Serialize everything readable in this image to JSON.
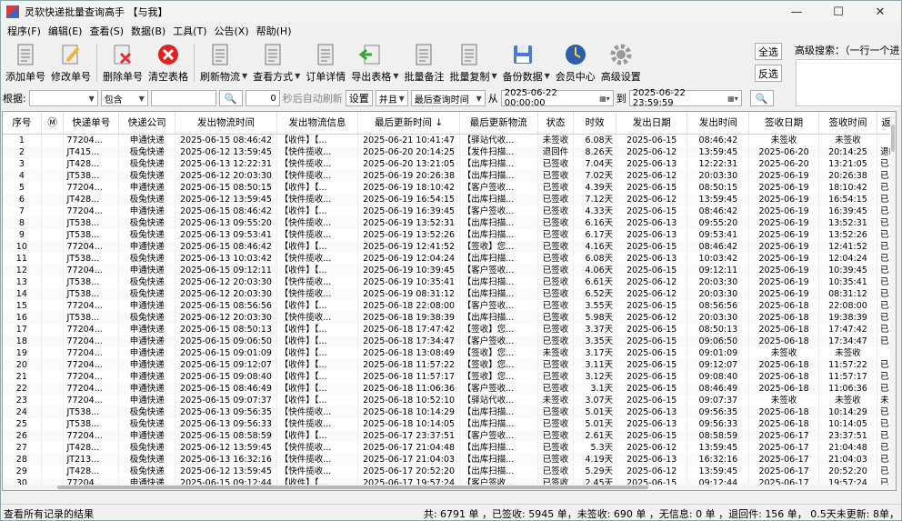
{
  "window": {
    "title": "灵软快递批量查询高手 【与我】"
  },
  "menu": [
    "程序(F)",
    "编辑(E)",
    "查看(S)",
    "数据(B)",
    "工具(T)",
    "公告(X)",
    "帮助(H)"
  ],
  "toolbar": [
    {
      "label": "添加单号",
      "icon": "add-document-icon",
      "color": "#e8e8e8",
      "arrow": false
    },
    {
      "label": "修改单号",
      "icon": "edit-pencil-icon",
      "color": "#f3b33d",
      "arrow": false
    },
    {
      "label": "删除单号",
      "icon": "delete-document-icon",
      "color": "#d33",
      "arrow": false
    },
    {
      "label": "清空表格",
      "icon": "clear-red-x-icon",
      "color": "#d22",
      "arrow": false
    },
    {
      "label": "刷新物流",
      "icon": "refresh-document-icon",
      "color": "#e8e8e8",
      "arrow": true
    },
    {
      "label": "查看方式",
      "icon": "view-list-icon",
      "color": "#e8e8e8",
      "arrow": true
    },
    {
      "label": "订单详情",
      "icon": "order-detail-icon",
      "color": "#e8e8e8",
      "arrow": false
    },
    {
      "label": "导出表格",
      "icon": "export-green-arrow-icon",
      "color": "#3a3",
      "arrow": true
    },
    {
      "label": "批量备注",
      "icon": "batch-note-icon",
      "color": "#e8e8e8",
      "arrow": false
    },
    {
      "label": "批量复制",
      "icon": "batch-copy-icon",
      "color": "#e8e8e8",
      "arrow": true
    },
    {
      "label": "备份数据",
      "icon": "floppy-disk-icon",
      "color": "#4a7bd0",
      "arrow": true
    },
    {
      "label": "会员中心",
      "icon": "member-clock-icon",
      "color": "#2c5da8",
      "arrow": false
    },
    {
      "label": "高级设置",
      "icon": "gear-icon",
      "color": "#999",
      "arrow": false
    }
  ],
  "select_buttons": {
    "all": "全选",
    "invert": "反选"
  },
  "advanced_search": {
    "label": "高级搜索：（一行一个进"
  },
  "filter": {
    "basis_label": "根据:",
    "field_value": "",
    "match_value": "包含",
    "keyword": "",
    "refresh_seconds": "0",
    "auto_refresh_label": "秒后自动刷新",
    "settings_label": "设置",
    "logic_value": "并且",
    "time_field_value": "最后查询时间",
    "from_label": "从",
    "from_value": "2025-06-22 00:00:00",
    "to_label": "到",
    "to_value": "2025-06-22 23:59:59"
  },
  "columns": [
    "序号",
    "Ⓜ",
    "快递单号",
    "快递公司",
    "发出物流时间",
    "发出物流信息",
    "最后更新时间 ↓",
    "最后更新物流",
    "状态",
    "时效",
    "发出日期",
    "发出时间",
    "签收日期",
    "签收时间",
    "返"
  ],
  "rows": [
    [
      "1",
      "",
      "77204...",
      "申通快递",
      "2025-06-15 08:46:42",
      "【收件】【...",
      "2025-06-21 10:41:47",
      "【驿站代收...",
      "未签收",
      "6.08天",
      "2025-06-15",
      "08:46:42",
      "未签收",
      "未签收",
      ""
    ],
    [
      "2",
      "",
      "JT415...",
      "极兔快递",
      "2025-06-12 13:59:45",
      "【快件揽收...",
      "2025-06-20 20:14:25",
      "【发件扫描...",
      "退回件",
      "8.26天",
      "2025-06-12",
      "13:59:45",
      "2025-06-20",
      "20:14:25",
      "退I"
    ],
    [
      "3",
      "",
      "JT428...",
      "极兔快递",
      "2025-06-13 12:22:31",
      "【快件揽收...",
      "2025-06-20 13:21:05",
      "【出库扫描...",
      "已签收",
      "7.04天",
      "2025-06-13",
      "12:22:31",
      "2025-06-20",
      "13:21:05",
      "已"
    ],
    [
      "4",
      "",
      "JT538...",
      "极兔快递",
      "2025-06-12 20:03:30",
      "【快件揽收...",
      "2025-06-19 20:26:38",
      "【出库扫描...",
      "已签收",
      "7.02天",
      "2025-06-12",
      "20:03:30",
      "2025-06-19",
      "20:26:38",
      "已"
    ],
    [
      "5",
      "",
      "77204...",
      "申通快递",
      "2025-06-15 08:50:15",
      "【收件】【...",
      "2025-06-19 18:10:42",
      "【客户签收...",
      "已签收",
      "4.39天",
      "2025-06-15",
      "08:50:15",
      "2025-06-19",
      "18:10:42",
      "已"
    ],
    [
      "6",
      "",
      "JT428...",
      "极兔快递",
      "2025-06-12 13:59:45",
      "【快件揽收...",
      "2025-06-19 16:54:15",
      "【出库扫描...",
      "已签收",
      "7.12天",
      "2025-06-12",
      "13:59:45",
      "2025-06-19",
      "16:54:15",
      "已"
    ],
    [
      "7",
      "",
      "77204...",
      "申通快递",
      "2025-06-15 08:46:42",
      "【收件】【...",
      "2025-06-19 16:39:45",
      "【客户签收...",
      "已签收",
      "4.33天",
      "2025-06-15",
      "08:46:42",
      "2025-06-19",
      "16:39:45",
      "已"
    ],
    [
      "8",
      "",
      "JT538...",
      "极兔快递",
      "2025-06-13 09:55:20",
      "【快件揽收...",
      "2025-06-19 13:52:31",
      "【出库扫描...",
      "已签收",
      "6.16天",
      "2025-06-13",
      "09:55:20",
      "2025-06-19",
      "13:52:31",
      "已"
    ],
    [
      "9",
      "",
      "JT538...",
      "极兔快递",
      "2025-06-13 09:53:41",
      "【快件揽收...",
      "2025-06-19 13:52:26",
      "【出库扫描...",
      "已签收",
      "6.17天",
      "2025-06-13",
      "09:53:41",
      "2025-06-19",
      "13:52:26",
      "已"
    ],
    [
      "10",
      "",
      "77204...",
      "申通快递",
      "2025-06-15 08:46:42",
      "【收件】【...",
      "2025-06-19 12:41:52",
      "【签收】您...",
      "已签收",
      "4.16天",
      "2025-06-15",
      "08:46:42",
      "2025-06-19",
      "12:41:52",
      "已"
    ],
    [
      "11",
      "",
      "JT538...",
      "极兔快递",
      "2025-06-13 10:03:42",
      "【快件揽收...",
      "2025-06-19 12:04:24",
      "【出库扫描...",
      "已签收",
      "6.08天",
      "2025-06-13",
      "10:03:42",
      "2025-06-19",
      "12:04:24",
      "已"
    ],
    [
      "12",
      "",
      "77204...",
      "申通快递",
      "2025-06-15 09:12:11",
      "【收件】【...",
      "2025-06-19 10:39:45",
      "【客户签收...",
      "已签收",
      "4.06天",
      "2025-06-15",
      "09:12:11",
      "2025-06-19",
      "10:39:45",
      "已"
    ],
    [
      "13",
      "",
      "JT538...",
      "极兔快递",
      "2025-06-12 20:03:30",
      "【快件揽收...",
      "2025-06-19 10:35:41",
      "【出库扫描...",
      "已签收",
      "6.61天",
      "2025-06-12",
      "20:03:30",
      "2025-06-19",
      "10:35:41",
      "已"
    ],
    [
      "14",
      "",
      "JT538...",
      "极兔快递",
      "2025-06-12 20:03:30",
      "【快件揽收...",
      "2025-06-19 08:31:12",
      "【出库扫描...",
      "已签收",
      "6.52天",
      "2025-06-12",
      "20:03:30",
      "2025-06-19",
      "08:31:12",
      "已"
    ],
    [
      "15",
      "",
      "77204...",
      "申通快递",
      "2025-06-15 08:56:56",
      "【收件】【...",
      "2025-06-18 22:08:00",
      "【客户签收...",
      "已签收",
      "3.55天",
      "2025-06-15",
      "08:56:56",
      "2025-06-18",
      "22:08:00",
      "已"
    ],
    [
      "16",
      "",
      "JT538...",
      "极兔快递",
      "2025-06-12 20:03:30",
      "【快件揽收...",
      "2025-06-18 19:38:39",
      "【出库扫描...",
      "已签收",
      "5.98天",
      "2025-06-12",
      "20:03:30",
      "2025-06-18",
      "19:38:39",
      "已"
    ],
    [
      "17",
      "",
      "77204...",
      "申通快递",
      "2025-06-15 08:50:13",
      "【收件】【...",
      "2025-06-18 17:47:42",
      "【签收】您...",
      "已签收",
      "3.37天",
      "2025-06-15",
      "08:50:13",
      "2025-06-18",
      "17:47:42",
      "已"
    ],
    [
      "18",
      "",
      "77204...",
      "申通快递",
      "2025-06-15 09:06:50",
      "【收件】【...",
      "2025-06-18 17:34:47",
      "【客户签收...",
      "已签收",
      "3.35天",
      "2025-06-15",
      "09:06:50",
      "2025-06-18",
      "17:34:47",
      "已"
    ],
    [
      "19",
      "",
      "77204...",
      "申通快递",
      "2025-06-15 09:01:09",
      "【收件】【...",
      "2025-06-18 13:08:49",
      "【签收】您...",
      "未签收",
      "3.17天",
      "2025-06-15",
      "09:01:09",
      "未签收",
      "未签收",
      ""
    ],
    [
      "20",
      "",
      "77204...",
      "申通快递",
      "2025-06-15 09:12:07",
      "【收件】【...",
      "2025-06-18 11:57:22",
      "【签收】您...",
      "已签收",
      "3.11天",
      "2025-06-15",
      "09:12:07",
      "2025-06-18",
      "11:57:22",
      "已"
    ],
    [
      "21",
      "",
      "77204...",
      "申通快递",
      "2025-06-15 09:08:40",
      "【收件】【...",
      "2025-06-18 11:57:17",
      "【签收】您...",
      "已签收",
      "3.12天",
      "2025-06-15",
      "09:08:40",
      "2025-06-18",
      "11:57:17",
      "已"
    ],
    [
      "22",
      "",
      "77204...",
      "申通快递",
      "2025-06-15 08:46:49",
      "【收件】【...",
      "2025-06-18 11:06:36",
      "【客户签收...",
      "已签收",
      "3.1天",
      "2025-06-15",
      "08:46:49",
      "2025-06-18",
      "11:06:36",
      "已"
    ],
    [
      "23",
      "",
      "77204...",
      "申通快递",
      "2025-06-15 09:07:37",
      "【收件】【...",
      "2025-06-18 10:52:10",
      "【驿站代收...",
      "未签收",
      "3.07天",
      "2025-06-15",
      "09:07:37",
      "未签收",
      "未签收",
      "未"
    ],
    [
      "24",
      "",
      "JT538...",
      "极兔快递",
      "2025-06-13 09:56:35",
      "【快件揽收...",
      "2025-06-18 10:14:29",
      "【出库扫描...",
      "已签收",
      "5.01天",
      "2025-06-13",
      "09:56:35",
      "2025-06-18",
      "10:14:29",
      "已"
    ],
    [
      "25",
      "",
      "JT538...",
      "极兔快递",
      "2025-06-13 09:56:33",
      "【快件揽收...",
      "2025-06-18 10:14:05",
      "【出库扫描...",
      "已签收",
      "5.01天",
      "2025-06-13",
      "09:56:33",
      "2025-06-18",
      "10:14:05",
      "已"
    ],
    [
      "26",
      "",
      "77204...",
      "申通快递",
      "2025-06-15 08:58:59",
      "【收件】【...",
      "2025-06-17 23:37:51",
      "【客户签收...",
      "已签收",
      "2.61天",
      "2025-06-15",
      "08:58:59",
      "2025-06-17",
      "23:37:51",
      "已"
    ],
    [
      "27",
      "",
      "JT428...",
      "极兔快递",
      "2025-06-12 13:59:45",
      "【快件揽收...",
      "2025-06-17 21:04:48",
      "【出库扫描...",
      "已签收",
      "5.3天",
      "2025-06-12",
      "13:59:45",
      "2025-06-17",
      "21:04:48",
      "已"
    ],
    [
      "28",
      "",
      "JT213...",
      "极兔快递",
      "2025-06-13 16:32:16",
      "【快件揽收...",
      "2025-06-17 21:04:03",
      "【出库扫描...",
      "已签收",
      "4.19天",
      "2025-06-13",
      "16:32:16",
      "2025-06-17",
      "21:04:03",
      "已"
    ],
    [
      "29",
      "",
      "JT428...",
      "极兔快递",
      "2025-06-12 13:59:45",
      "【快件揽收...",
      "2025-06-17 20:52:20",
      "【出库扫描...",
      "已签收",
      "5.29天",
      "2025-06-12",
      "13:59:45",
      "2025-06-17",
      "20:52:20",
      "已"
    ],
    [
      "30",
      "",
      "77204...",
      "申通快递",
      "2025-06-15 09:12:44",
      "【收件】【...",
      "2025-06-17 19:57:24",
      "【客户签收...",
      "已签收",
      "2.45天",
      "2025-06-15",
      "09:12:44",
      "2025-06-17",
      "19:57:24",
      "已"
    ]
  ],
  "status": {
    "left": "查看所有记录的结果",
    "right": "共: 6791 单 ，已签收:  5945 单，未签收:  690 单 ，无信息: 0 单 ，退回件: 156 单， 0.5天未更新: 8单，"
  }
}
